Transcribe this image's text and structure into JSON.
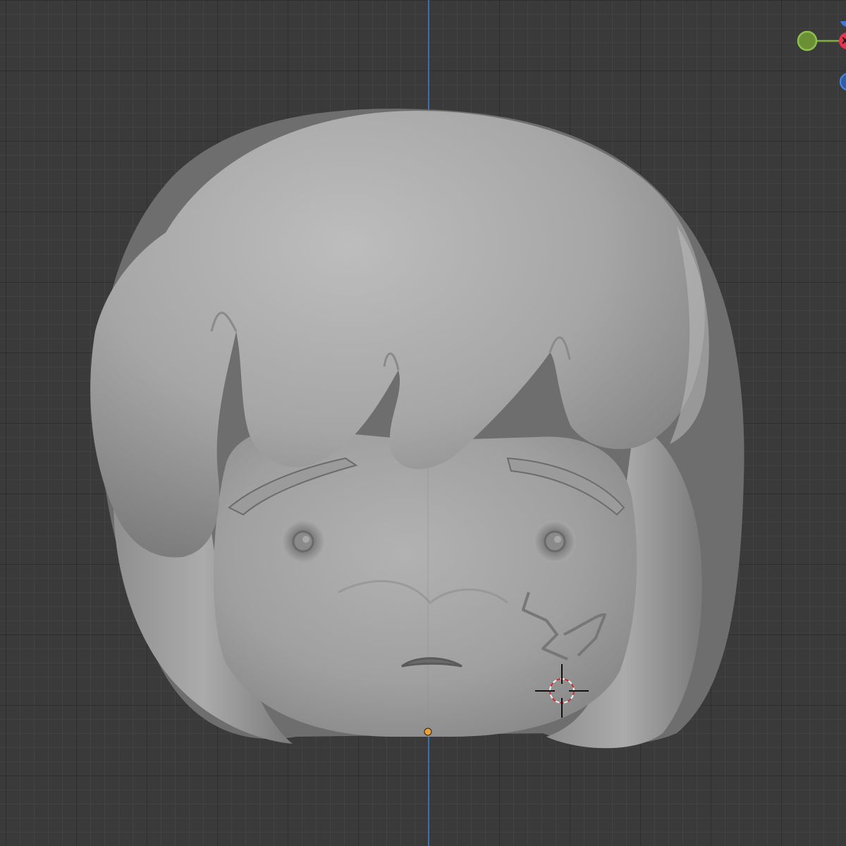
{
  "viewport": {
    "background_color": "#3a3a3a",
    "grid_color": "#2b2b2b",
    "z_axis_color": "#3d6fb0"
  },
  "model": {
    "material_color": "#a8a8a8",
    "origin_color": "#f0a030"
  },
  "navigation_gizmo": {
    "y_axis_color": "#7fb042",
    "x_axis_color": "#e0364f",
    "z_axis_color": "#3d7ad8",
    "x_label": "X"
  },
  "cursor_3d": {
    "ring_color_a": "#d03030",
    "ring_color_b": "#f0f0f0"
  }
}
